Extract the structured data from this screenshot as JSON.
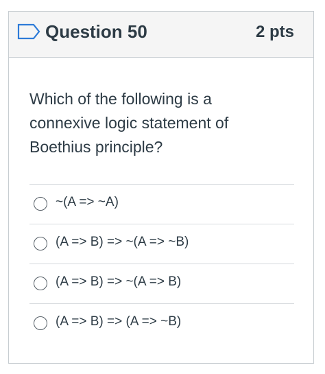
{
  "question": {
    "title": "Question 50",
    "points": "2 pts",
    "text": "Which of the following is a connexive logic statement of Boethius principle?",
    "flag_icon": "flag-outline-icon",
    "accent_color": "#2d7bd8"
  },
  "answers": [
    {
      "label": "~(A => ~A)",
      "selected": false
    },
    {
      "label": "(A => B) => ~(A => ~B)",
      "selected": false
    },
    {
      "label": "(A => B) => ~(A => B)",
      "selected": false
    },
    {
      "label": "(A => B) => (A => ~B)",
      "selected": false
    }
  ]
}
